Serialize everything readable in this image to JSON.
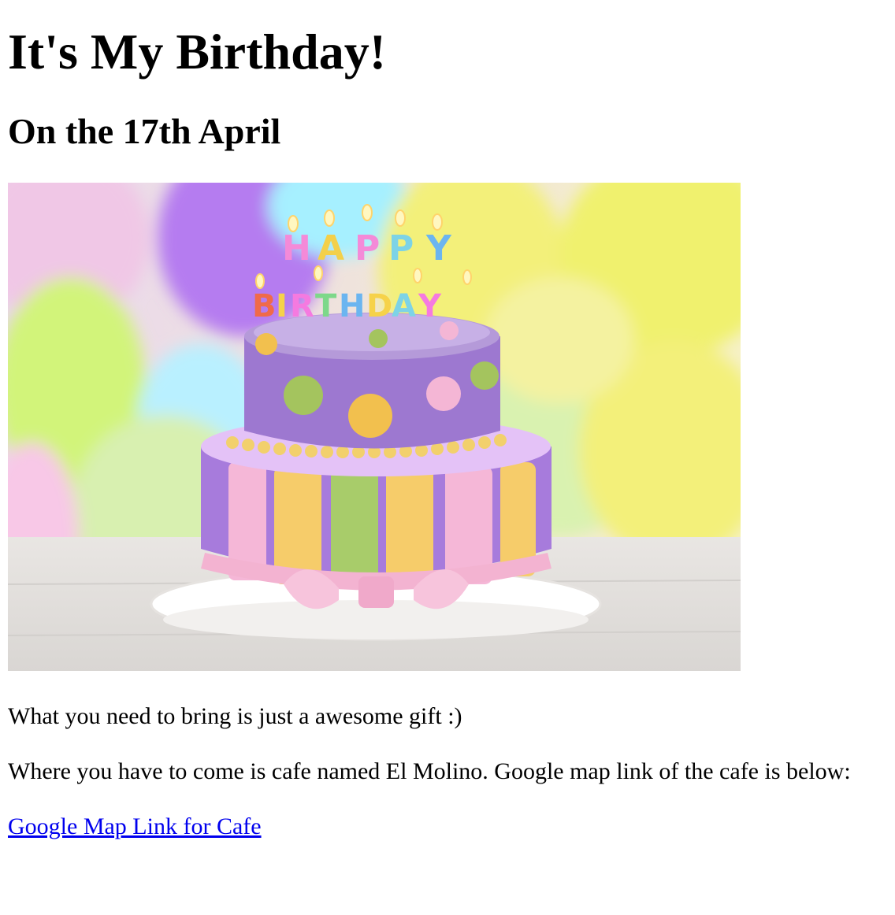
{
  "page": {
    "title": "It's My Birthday!",
    "subtitle": "On the 17th April",
    "image": {
      "kind": "birthday-cake-photo",
      "candle_text_top": "HAPPY",
      "candle_text_bottom": "BIRTHDAY"
    },
    "paragraphs": {
      "bring": "What you need to bring is just a awesome gift :)",
      "where": "Where you have to come is cafe named El Molino. Google map link of the cafe is below:"
    },
    "link": {
      "label": "Google Map Link for Cafe",
      "color": "#0000ee"
    }
  }
}
